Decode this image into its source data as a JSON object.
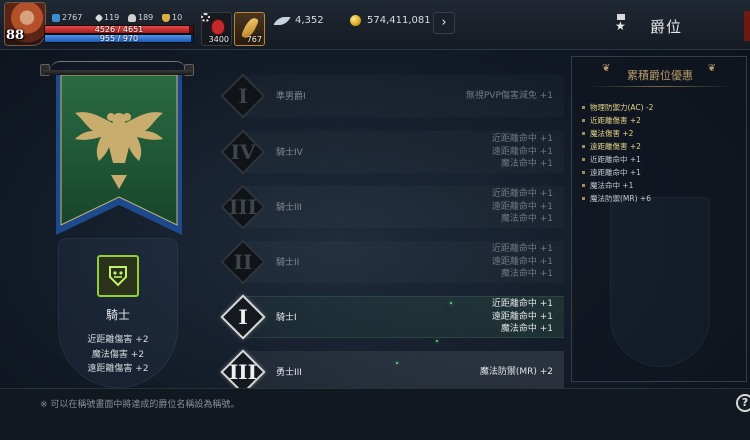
{
  "player": {
    "level": "88",
    "stat_1": "2767",
    "stat_2": "119",
    "stat_3": "189",
    "stat_4": "10",
    "hp_text": "4526 / 4651",
    "hp_fraction": 0.973,
    "mp_text": "955 / 970",
    "mp_fraction": 0.985
  },
  "quick_slots": {
    "potion_count": "3400",
    "feather_count": "767"
  },
  "currency": {
    "wing_amount": "4,352",
    "gold_amount": "574,411,081"
  },
  "header": {
    "title": "爵位",
    "title_icon": "medal-icon"
  },
  "class_info": {
    "name": "騎士",
    "bonuses": [
      "近距離傷害 +2",
      "魔法傷害 +2",
      "遠距離傷害 +2"
    ]
  },
  "ranks": [
    {
      "numeral": "I",
      "name": "準男爵I",
      "status": "locked",
      "effects": [
        "無視PVP傷害減免 +1"
      ]
    },
    {
      "numeral": "IV",
      "name": "騎士IV",
      "status": "locked",
      "effects": [
        "近距離命中 +1",
        "遠距離命中 +1",
        "魔法命中 +1"
      ]
    },
    {
      "numeral": "III",
      "name": "騎士III",
      "status": "locked",
      "effects": [
        "近距離命中 +1",
        "遠距離命中 +1",
        "魔法命中 +1"
      ]
    },
    {
      "numeral": "II",
      "name": "騎士II",
      "status": "locked",
      "effects": [
        "近距離命中 +1",
        "遠距離命中 +1",
        "魔法命中 +1"
      ]
    },
    {
      "numeral": "I",
      "name": "騎士I",
      "status": "current",
      "effects": [
        "近距離命中 +1",
        "遠距離命中 +1",
        "魔法命中 +1"
      ]
    },
    {
      "numeral": "III",
      "name": "勇士III",
      "status": "next",
      "effects": [
        "魔法防禦(MR) +2"
      ]
    }
  ],
  "cumulative": {
    "title": "累積爵位優惠",
    "items": [
      {
        "text": "物理防禦力(AC) -2",
        "highlight": true
      },
      {
        "text": "近距離傷害 +2",
        "highlight": true
      },
      {
        "text": "魔法傷害 +2",
        "highlight": true
      },
      {
        "text": "遠距離傷害 +2",
        "highlight": true
      },
      {
        "text": "近距離命中 +1",
        "highlight": false
      },
      {
        "text": "遠距離命中 +1",
        "highlight": false
      },
      {
        "text": "魔法命中 +1",
        "highlight": false
      },
      {
        "text": "魔法防禦(MR) +6",
        "highlight": false
      }
    ]
  },
  "footer": {
    "note": "※ 可以在稱號畫面中將達成的爵位名稱設為稱號。",
    "help_label": "?"
  },
  "colors": {
    "banner_green": "#1f5a36",
    "banner_blue": "#1c4a8c",
    "badge_accent": "#8fd12f",
    "cumulative_highlight": "#e7d48a"
  }
}
